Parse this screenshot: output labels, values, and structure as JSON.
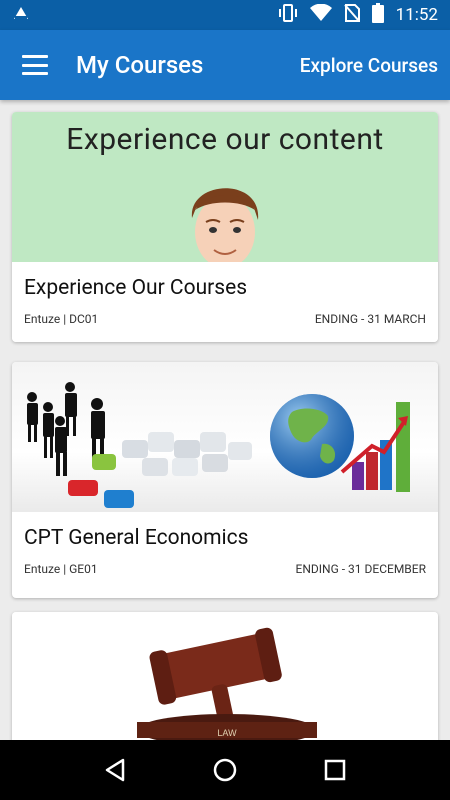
{
  "status_bar": {
    "time": "11:52",
    "icons": [
      "android-notification-icon",
      "vibrate-icon",
      "wifi-icon",
      "no-sim-icon",
      "battery-icon"
    ]
  },
  "app_bar": {
    "title": "My Courses",
    "action_label": "Explore Courses",
    "menu_icon": "hamburger-menu-icon",
    "color": "#1a75c8"
  },
  "courses": [
    {
      "image_headline": "Experience our content",
      "title": "Experience Our Courses",
      "code": "Entuze | DC01",
      "ending": "ENDING - 31 MARCH"
    },
    {
      "title": "CPT General Economics",
      "code": "Entuze | GE01",
      "ending": "ENDING - 31 DECEMBER"
    },
    {
      "image_label": "LAW"
    }
  ],
  "nav_bar": {
    "icons": [
      "back-icon",
      "home-icon",
      "recents-icon"
    ]
  }
}
